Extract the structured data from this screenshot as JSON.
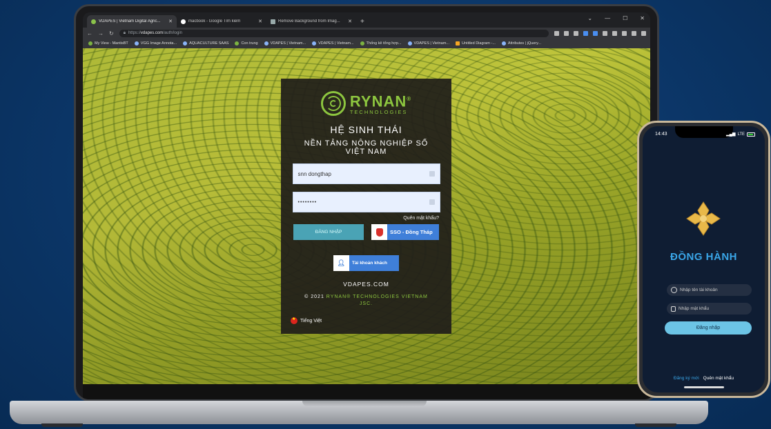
{
  "browser": {
    "tabs": [
      {
        "title": "VDAPES | Vietnam Digital Agric...",
        "active": true
      },
      {
        "title": "macbook - Google Tìm kiếm",
        "active": false
      },
      {
        "title": "Remove Background from Imag...",
        "active": false
      }
    ],
    "new_tab": "+",
    "url_prefix": "https://",
    "url_host": "vdapes.com",
    "url_path": "/auth/login",
    "bookmarks": [
      "My View - MantisBT",
      "VGG Image Annota...",
      "AQUACULTURE SAAS",
      "Con trung",
      "VDAPES | Vietnam...",
      "VDAPES | Vietnam...",
      "Thống kê tổng hợp...",
      "VDAPES | Vietnam...",
      "Untitled Diagram -...",
      "Attributes | jQuery..."
    ]
  },
  "login": {
    "brand": "RYNAN",
    "brand_sup": "®",
    "brand_sub": "TECHNOLOGIES",
    "heading": "HỆ SINH THÁI",
    "subheading": "NỀN TẢNG NÔNG NGHIỆP SỐ VIỆT NAM",
    "username_value": "snn dongthap",
    "password_value": "••••••••",
    "forgot": "Quên mật khẩu?",
    "login_button": "ĐĂNG NHẬP",
    "sso_button": "SSO - Đồng Tháp",
    "guest_button": "Tài khoản khách",
    "site": "VDAPES.COM",
    "copyright_prefix": "© 2021 ",
    "copyright_company": "RYNAN® TECHNOLOGIES VIETNAM JSC.",
    "language": "Tiếng Việt"
  },
  "phone": {
    "time": "14:43",
    "signal": "LTE",
    "title": "ĐỒNG HÀNH",
    "username_placeholder": "Nhập tên tài khoản",
    "password_placeholder": "Nhập mật khẩu",
    "login_button": "Đăng nhập",
    "register": "Đăng ký mới",
    "forgot": "Quên mật khẩu"
  },
  "colors": {
    "brand_green": "#8dc63f",
    "login_button": "#4aa3b5",
    "sso_blue": "#3f7fd9",
    "phone_title": "#3aa6e8",
    "background": "#0b3566"
  }
}
